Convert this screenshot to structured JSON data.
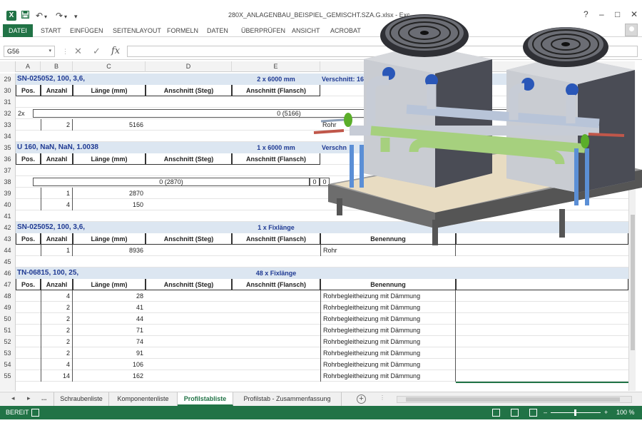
{
  "window": {
    "title": "280X_ANLAGENBAU_BEISPIEL_GEMISCHT.SZA.G.xlsx - Exc",
    "app_icon": "X",
    "minimize": "–",
    "restore": "□",
    "close": "✕",
    "help": "?"
  },
  "qat": {
    "save_icon": "floppy-icon",
    "undo": "↶",
    "redo": "↷",
    "customize": "▾"
  },
  "ribbon": {
    "tabs": [
      "DATEI",
      "START",
      "EINFÜGEN",
      "SEITENLAYOUT",
      "FORMELN",
      "DATEN",
      "ÜBERPRÜFEN",
      "ANSICHT",
      "ACROBAT"
    ]
  },
  "formula_bar": {
    "name_box": "G56",
    "cancel": "✕",
    "enter": "✓",
    "fx": "fx",
    "value": ""
  },
  "columns": [
    "A",
    "B",
    "C",
    "D",
    "E"
  ],
  "rows": {
    "r29": {
      "n": "29",
      "title": "SN-025052, 100, 3,6,",
      "mid": "2 x 6000 mm",
      "right": "Verschnitt: 16"
    },
    "r30": {
      "n": "30",
      "h": [
        "Pos.",
        "Anzahl",
        "Länge (mm)",
        "Anschnitt (Steg)",
        "Anschnitt (Flansch)"
      ]
    },
    "r31": {
      "n": "31"
    },
    "r32": {
      "n": "32",
      "a": "2x",
      "bar": "0 (5166)"
    },
    "r33": {
      "n": "33",
      "b": "2",
      "c": "5166",
      "f": "Rohr"
    },
    "r34": {
      "n": "34"
    },
    "r35": {
      "n": "35",
      "title": "U 160, NaN, NaN, 1.0038",
      "mid": "1 x 6000 mm",
      "right": "Verschn"
    },
    "r36": {
      "n": "36",
      "h": [
        "Pos.",
        "Anzahl",
        "Länge (mm)",
        "Anschnitt (Steg)",
        "Anschnitt (Flansch)"
      ]
    },
    "r37": {
      "n": "37"
    },
    "r38": {
      "n": "38",
      "bar": "0 (2870)",
      "z1": "0",
      "z2": "0"
    },
    "r39": {
      "n": "39",
      "b": "1",
      "c": "2870"
    },
    "r40": {
      "n": "40",
      "b": "4",
      "c": "150"
    },
    "r41": {
      "n": "41"
    },
    "r42": {
      "n": "42",
      "title": "SN-025052, 100, 3,6,",
      "mid": "1 x Fixlänge"
    },
    "r43": {
      "n": "43",
      "h": [
        "Pos.",
        "Anzahl",
        "Länge (mm)",
        "Anschnitt (Steg)",
        "Anschnitt (Flansch)",
        "Benennung"
      ]
    },
    "r44": {
      "n": "44",
      "b": "1",
      "c": "8936",
      "f": "Rohr"
    },
    "r45": {
      "n": "45"
    },
    "r46": {
      "n": "46",
      "title": "TN-06815, 100, 25,",
      "mid": "48 x Fixlänge"
    },
    "r47": {
      "n": "47",
      "h": [
        "Pos.",
        "Anzahl",
        "Länge (mm)",
        "Anschnitt (Steg)",
        "Anschnitt (Flansch)",
        "Benennung"
      ]
    },
    "data": [
      {
        "n": "48",
        "b": "4",
        "c": "28",
        "f": "Rohrbegleitheizung mit Dämmung"
      },
      {
        "n": "49",
        "b": "2",
        "c": "41",
        "f": "Rohrbegleitheizung mit Dämmung"
      },
      {
        "n": "50",
        "b": "2",
        "c": "44",
        "f": "Rohrbegleitheizung mit Dämmung"
      },
      {
        "n": "51",
        "b": "2",
        "c": "71",
        "f": "Rohrbegleitheizung mit Dämmung"
      },
      {
        "n": "52",
        "b": "2",
        "c": "74",
        "f": "Rohrbegleitheizung mit Dämmung"
      },
      {
        "n": "53",
        "b": "2",
        "c": "91",
        "f": "Rohrbegleitheizung mit Dämmung"
      },
      {
        "n": "54",
        "b": "4",
        "c": "106",
        "f": "Rohrbegleitheizung mit Dämmung"
      },
      {
        "n": "55",
        "b": "14",
        "c": "162",
        "f": "Rohrbegleitheizung mit Dämmung"
      }
    ]
  },
  "sheet_tabs": {
    "prev": "◂",
    "next": "▸",
    "more": "...",
    "tabs": [
      "Schraubenliste",
      "Komponentenliste",
      "Profilstabliste",
      "Profilstab - Zusammenfassung"
    ],
    "add": "+"
  },
  "status": {
    "ready": "BEREIT",
    "zoom": "100 %",
    "zoom_out": "–",
    "zoom_in": "+"
  },
  "colors": {
    "excel_green": "#217346",
    "band_blue": "#dce6f1",
    "title_blue": "#1f3a93"
  }
}
